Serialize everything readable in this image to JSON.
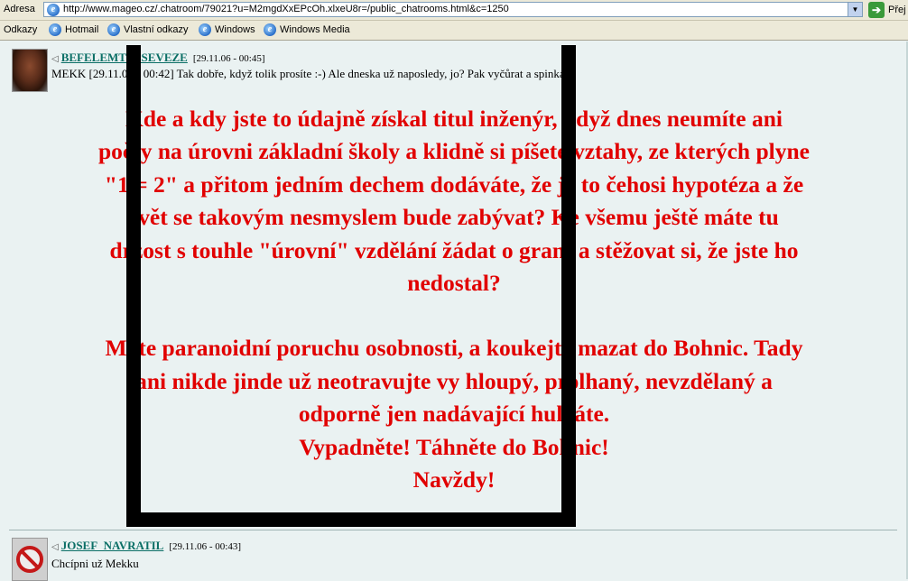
{
  "browser": {
    "address_label": "Adresa",
    "url": "http://www.mageo.cz/.chatroom/79021?u=M2mgdXxEPcOh.xlxeU8r=/public_chatrooms.html&c=1250",
    "go_label": "Přej",
    "links_label": "Odkazy",
    "links": [
      "Hotmail",
      "Vlastní odkazy",
      "Windows",
      "Windows Media"
    ]
  },
  "messages": [
    {
      "user": "BEFELEMTPESEVEZE",
      "date": "[29.11.06 - 00:45]",
      "text": "MEKK [29.11.06 - 00:42] Tak dobře, když tolik prosíte :-) Ale dneska už naposledy, jo? Pak vyčůrat a spinkat!",
      "big_text": [
        "Kde a kdy jste to údajně získal titul inženýr, když dnes neumíte ani",
        "počty na úrovni základní školy a klidně si píšete vztahy, ze kterých plyne",
        "\"1 = 2\" a přitom jedním dechem dodáváte, že je to čehosi hypotéza a že",
        "svět se takovým nesmyslem bude zabývat? Ke všemu ještě máte tu",
        "drzost s touhle \"úrovní\" vzdělání žádat o grant a stěžovat si, že jste ho",
        "nedostal?",
        "",
        "Máte paranoidní poruchu osobnosti, a koukejte mazat do Bohnic. Tady",
        "ani nikde jinde už neotravujte vy hloupý, prolhaný, nevzdělaný a",
        "odporně jen nadávající hulváte.",
        "Vypadněte! Táhněte do Bohnic!",
        "Navždy!"
      ]
    },
    {
      "user": "JOSEF_NAVRATIL",
      "date": "[29.11.06 - 00:43]",
      "text": "Chcípni už Mekku"
    }
  ],
  "colors": {
    "highlight_text": "#e10000",
    "username": "#0b6f66",
    "page_bg": "#eaf2f2"
  }
}
